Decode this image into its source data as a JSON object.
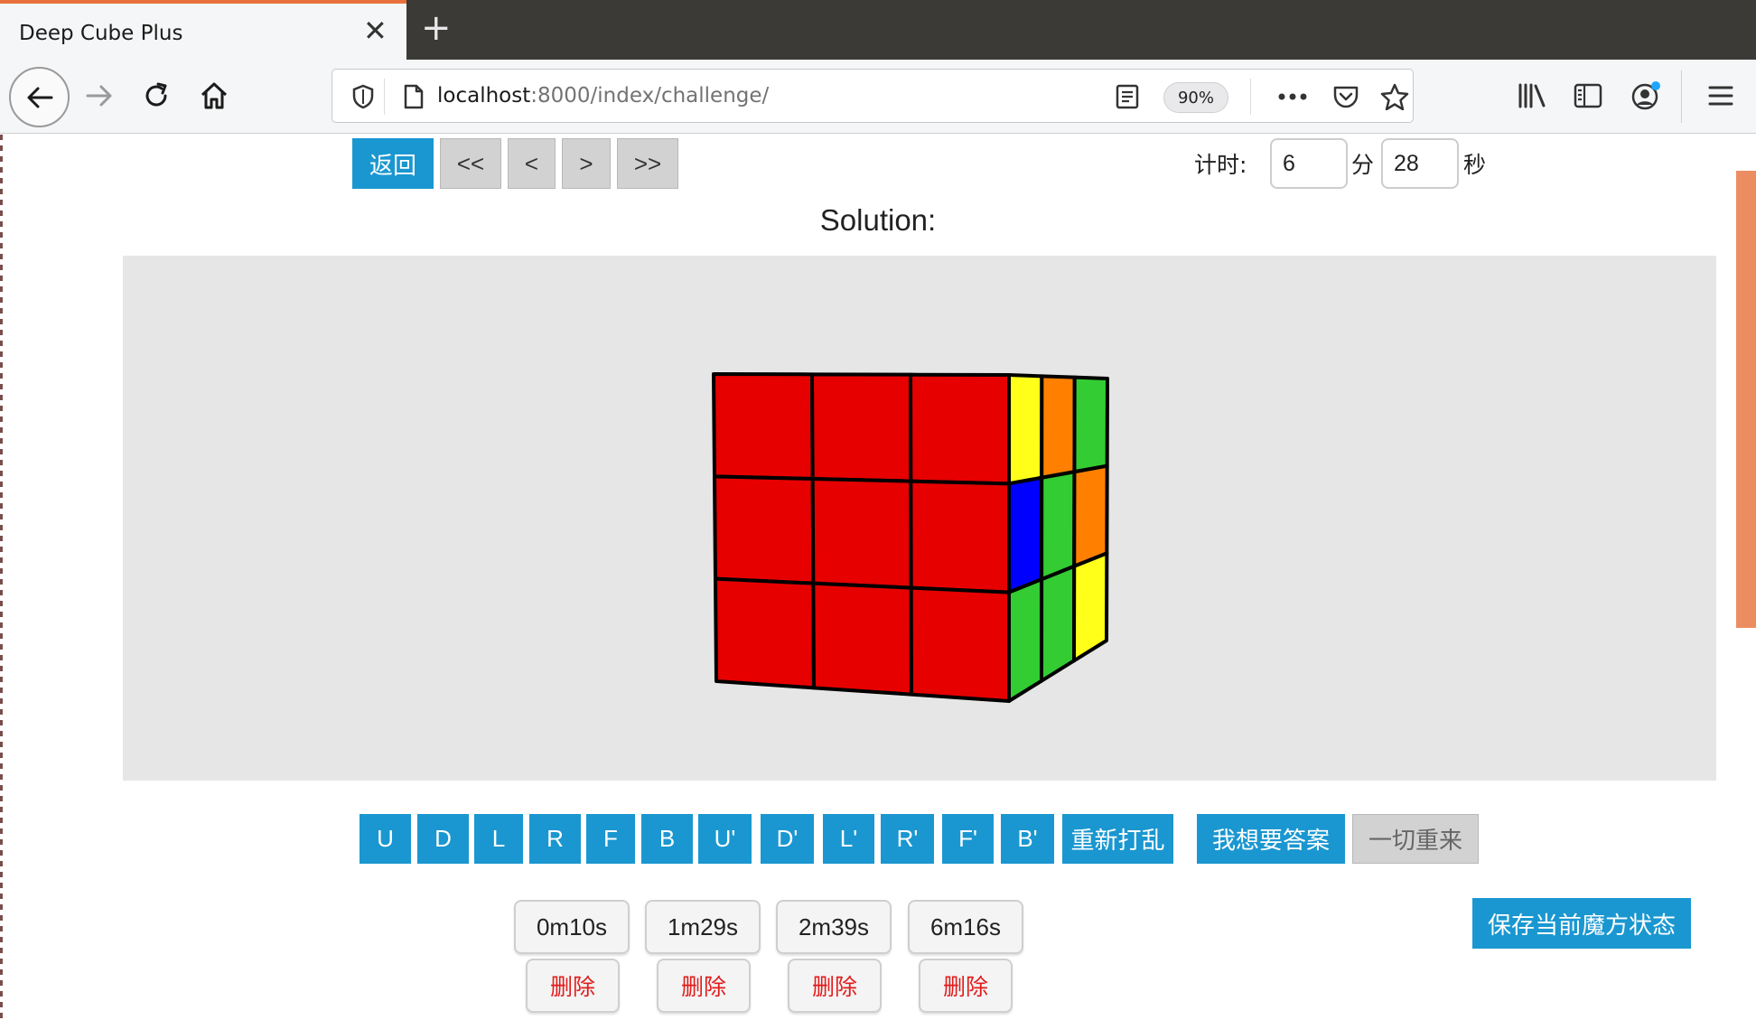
{
  "browser": {
    "tab_title": "Deep Cube Plus",
    "tab_close": "✕",
    "new_tab": "+",
    "url_host": "localhost",
    "url_path": ":8000/index/challenge/",
    "zoom": "90%"
  },
  "nav": {
    "back_label": "返回",
    "first_label": "<<",
    "prev_label": "<",
    "next_label": ">",
    "last_label": ">>"
  },
  "timer": {
    "label": "计时:",
    "minutes": "6",
    "minutes_unit": "分",
    "seconds": "28",
    "seconds_unit": "秒"
  },
  "solution_title": "Solution:",
  "cube": {
    "front": [
      [
        "#e60000",
        "#e60000",
        "#e60000"
      ],
      [
        "#e60000",
        "#e60000",
        "#e60000"
      ],
      [
        "#e60000",
        "#e60000",
        "#e60000"
      ]
    ],
    "right": [
      [
        "#ffff1a",
        "#ff8000",
        "#33cc33"
      ],
      [
        "#0000ff",
        "#33cc33",
        "#ff8000"
      ],
      [
        "#33cc33",
        "#33cc33",
        "#ffff1a"
      ]
    ]
  },
  "moves": [
    "U",
    "D",
    "L",
    "R",
    "F",
    "B",
    "U'",
    "D'",
    "L'",
    "R'",
    "F'",
    "B'"
  ],
  "actions": {
    "rescramble": "重新打乱",
    "want_answer": "我想要答案",
    "restart_all": "一切重来",
    "save_state": "保存当前魔方状态"
  },
  "saved_times": [
    "0m10s",
    "1m29s",
    "2m39s",
    "6m16s"
  ],
  "delete_label": "删除",
  "colors": {
    "accent": "#1a97d0",
    "delete_text": "#e11b1b",
    "tab_accent": "#e8713b",
    "scrollbar": "#ec8d61"
  }
}
